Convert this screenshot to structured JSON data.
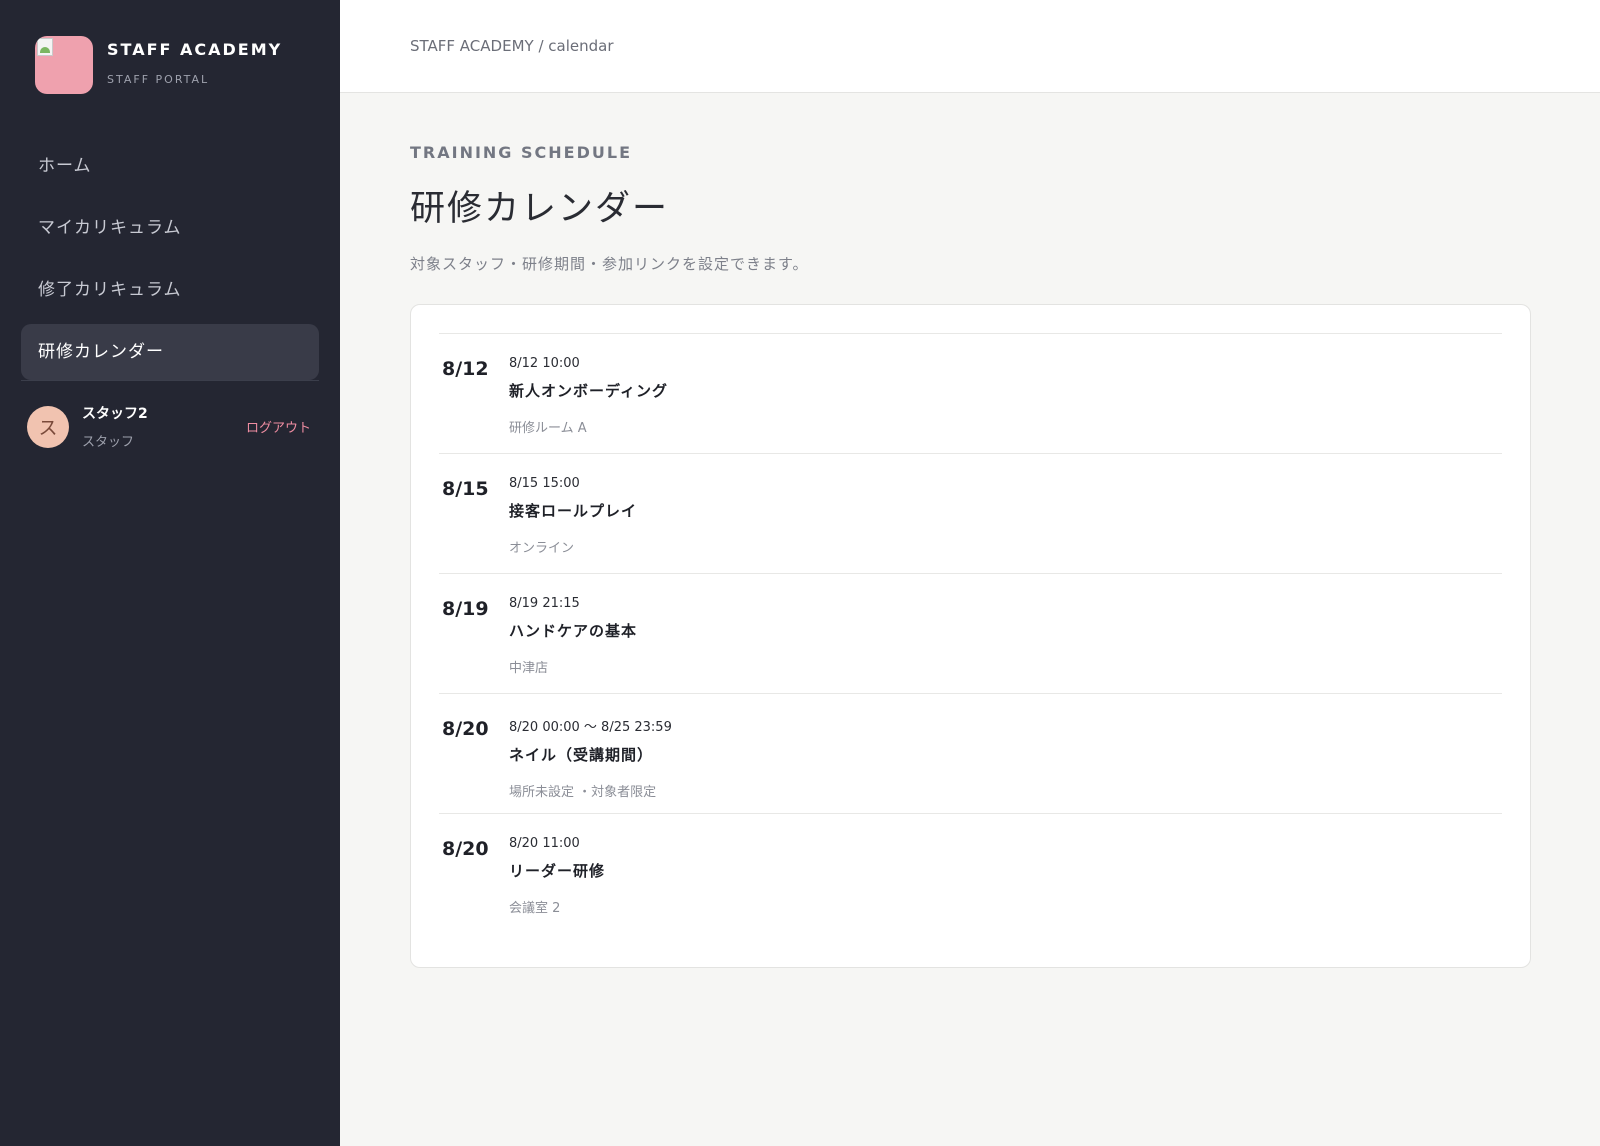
{
  "sidebar": {
    "brand_title": "STAFF ACADEMY",
    "brand_subtitle": "STAFF PORTAL",
    "nav": [
      {
        "label": "ホーム",
        "active": false
      },
      {
        "label": "マイカリキュラム",
        "active": false
      },
      {
        "label": "修了カリキュラム",
        "active": false
      },
      {
        "label": "研修カレンダー",
        "active": true
      }
    ],
    "user": {
      "avatar_initial": "ス",
      "name": "スタッフ2",
      "role": "スタッフ",
      "logout_label": "ログアウト"
    }
  },
  "header": {
    "breadcrumb": "STAFF ACADEMY / calendar"
  },
  "main": {
    "eyebrow": "TRAINING SCHEDULE",
    "title": "研修カレンダー",
    "description": "対象スタッフ・研修期間・参加リンクを設定できます。",
    "events": [
      {
        "date": "8/12",
        "time": "8/12 10:00",
        "title": "新人オンボーディング",
        "meta": "研修ルーム A"
      },
      {
        "date": "8/15",
        "time": "8/15 15:00",
        "title": "接客ロールプレイ",
        "meta": "オンライン"
      },
      {
        "date": "8/19",
        "time": "8/19 21:15",
        "title": "ハンドケアの基本",
        "meta": "中津店"
      },
      {
        "date": "8/20",
        "time": "8/20 00:00 〜 8/25 23:59",
        "title": "ネイル（受講期間）",
        "meta": "場所未設定 ・対象者限定"
      },
      {
        "date": "8/20",
        "time": "8/20 11:00",
        "title": "リーダー研修",
        "meta": "会議室 2"
      }
    ]
  },
  "colors": {
    "sidebar_bg": "#242632",
    "active_nav_bg": "#393b48",
    "logo_bg": "#efa1ae",
    "avatar_bg": "#f1c3b0",
    "logout_accent": "#f08da2",
    "page_bg": "#f6f6f4"
  },
  "icons": {
    "logo": "broken-image-icon"
  }
}
